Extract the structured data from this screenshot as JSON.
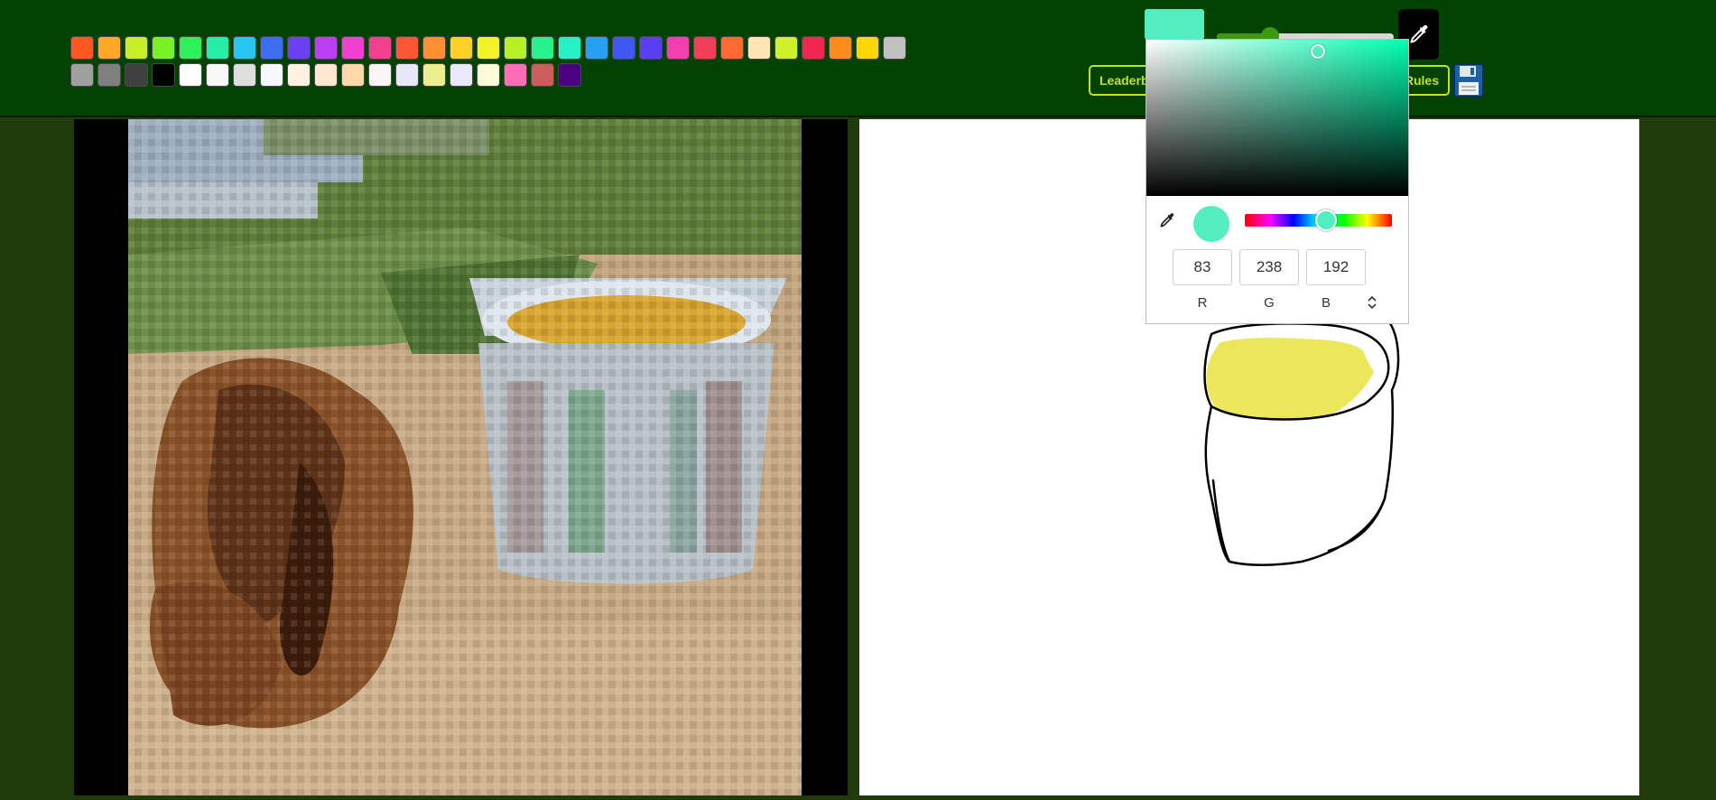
{
  "palette": {
    "row1": [
      "#ff5722",
      "#ffa726",
      "#c6ef27",
      "#76f227",
      "#2ef05b",
      "#27eea7",
      "#27c6ee",
      "#3f6df2",
      "#6b3ff2",
      "#bb3ff2",
      "#f23fd0",
      "#f23f8e",
      "#ff5733",
      "#ff8f33",
      "#ffd027",
      "#f2f227",
      "#b4f227",
      "#27f28c",
      "#27f2c6",
      "#27a0f2",
      "#3f58f2",
      "#5a3ff2",
      "#f23fae",
      "#f23f58",
      "#ff6a33",
      "#ffe4b5",
      "#cdf227",
      "#f2274f",
      "#ff8c1a",
      "#ffd700",
      "#c0c0c0"
    ],
    "row2": [
      "#a0a0a0",
      "#808080",
      "#404040",
      "#000000",
      "#ffffff",
      "#f8f8f8",
      "#dedede",
      "#f5f8ff",
      "#fff0e0",
      "#ffe8d2",
      "#ffd8a8",
      "#fbf6f6",
      "#e6e8fa",
      "#eeee90",
      "#e8e8fa",
      "#fffbd8",
      "#ff6eb4",
      "#cd5c5c",
      "#4b0082"
    ]
  },
  "toolbar": {
    "current_color": "#53eec0",
    "brush_size_fraction": 0.3,
    "leaderboard_label": "Leaderboard",
    "rules_label": "Rules",
    "icons": {
      "eyedropper": "eyedropper-icon",
      "save": "floppy-disk-icon"
    }
  },
  "color_picker": {
    "hex": "#53eec0",
    "hue_fraction": 0.55,
    "saturation": 0.65,
    "value": 0.93,
    "r": "83",
    "g": "238",
    "b": "192",
    "r_label": "R",
    "g_label": "G",
    "b_label": "B"
  },
  "drawing": {
    "fill_color": "#ebe65a",
    "stroke_color": "#000000"
  }
}
